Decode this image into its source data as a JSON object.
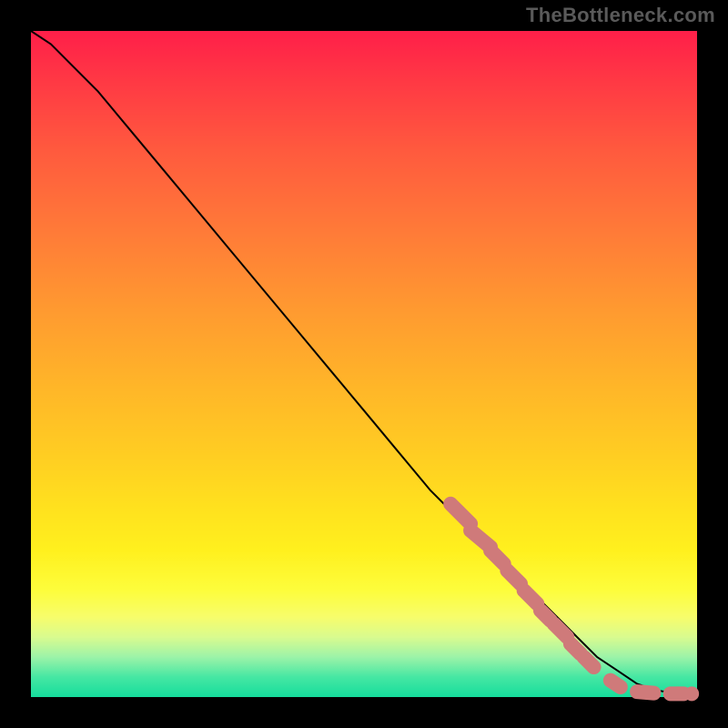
{
  "watermark": "TheBottleneck.com",
  "colors": {
    "marker": "#cf7a7a",
    "curve": "#000000"
  },
  "chart_data": {
    "type": "line",
    "title": "",
    "xlabel": "",
    "ylabel": "",
    "xlim": [
      0,
      100
    ],
    "ylim": [
      0,
      100
    ],
    "grid": false,
    "legend": false,
    "series": [
      {
        "name": "curve",
        "x": [
          0,
          3,
          6,
          10,
          15,
          20,
          25,
          30,
          35,
          40,
          45,
          50,
          55,
          60,
          65,
          70,
          75,
          80,
          85,
          88,
          91,
          94,
          97,
          100
        ],
        "y": [
          100,
          98,
          95,
          91,
          85,
          79,
          73,
          67,
          61,
          55,
          49,
          43,
          37,
          31,
          26,
          21,
          16,
          11,
          6,
          4,
          2,
          1,
          0.5,
          0.5
        ]
      }
    ],
    "markers": [
      {
        "kind": "segment",
        "x1": 63,
        "y1": 29,
        "x2": 66,
        "y2": 26
      },
      {
        "kind": "segment",
        "x1": 66,
        "y1": 25,
        "x2": 69,
        "y2": 22.5
      },
      {
        "kind": "segment",
        "x1": 69,
        "y1": 22,
        "x2": 71,
        "y2": 20
      },
      {
        "kind": "segment",
        "x1": 71.5,
        "y1": 19,
        "x2": 73.5,
        "y2": 17
      },
      {
        "kind": "segment",
        "x1": 74,
        "y1": 16,
        "x2": 76,
        "y2": 14
      },
      {
        "kind": "segment",
        "x1": 76.5,
        "y1": 13,
        "x2": 78,
        "y2": 11.5
      },
      {
        "kind": "segment",
        "x1": 78.5,
        "y1": 11,
        "x2": 80.5,
        "y2": 9
      },
      {
        "kind": "segment",
        "x1": 81,
        "y1": 8,
        "x2": 82.5,
        "y2": 6.5
      },
      {
        "kind": "segment",
        "x1": 83,
        "y1": 6,
        "x2": 84.5,
        "y2": 4.5
      },
      {
        "kind": "segment",
        "x1": 87,
        "y1": 2.5,
        "x2": 88.5,
        "y2": 1.5
      },
      {
        "kind": "segment",
        "x1": 91,
        "y1": 0.8,
        "x2": 93.5,
        "y2": 0.6
      },
      {
        "kind": "segment",
        "x1": 96,
        "y1": 0.5,
        "x2": 98,
        "y2": 0.5
      },
      {
        "kind": "point",
        "x": 99.2,
        "y": 0.5
      }
    ]
  }
}
